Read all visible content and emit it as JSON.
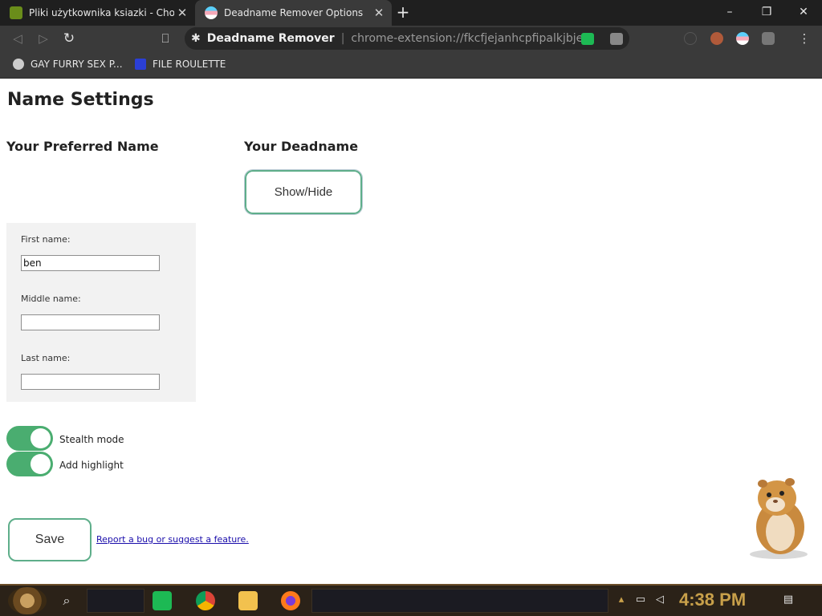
{
  "browser": {
    "tabs": [
      {
        "title": "Pliki użytkownika ksiazki - Chomi",
        "active": false
      },
      {
        "title": "Deadname Remover Options",
        "active": true
      }
    ],
    "new_tab": "+",
    "omnibox": {
      "site": "Deadname Remover",
      "separator": "|",
      "url": "chrome-extension://fkcfjejanhcpfipalkjbjea..."
    },
    "bookmarks": [
      {
        "label": "GAY FURRY SEX P...",
        "icon": "globe-icon"
      },
      {
        "label": "FILE ROULETTE",
        "icon": "mf-icon"
      }
    ],
    "window_controls": [
      "–",
      "❐",
      "✕"
    ]
  },
  "page": {
    "title": "Name Settings",
    "preferred_heading": "Your Preferred Name",
    "deadname_heading": "Your Deadname",
    "show_hide_label": "Show/Hide",
    "fields": {
      "first_label": "First name:",
      "first_value": "ben",
      "middle_label": "Middle name:",
      "middle_value": "",
      "last_label": "Last name:",
      "last_value": ""
    },
    "toggles": [
      {
        "label": "Stealth mode",
        "on": true
      },
      {
        "label": "Add highlight",
        "on": true
      }
    ],
    "save_label": "Save",
    "report_link": "Report a bug or suggest a feature.",
    "accent_color": "#5eae8a",
    "toggle_color": "#4aad70"
  },
  "taskbar": {
    "clock": "4:38 PM",
    "apps": [
      "spotify-icon",
      "chrome-icon",
      "file-explorer-icon",
      "firefox-icon"
    ]
  }
}
